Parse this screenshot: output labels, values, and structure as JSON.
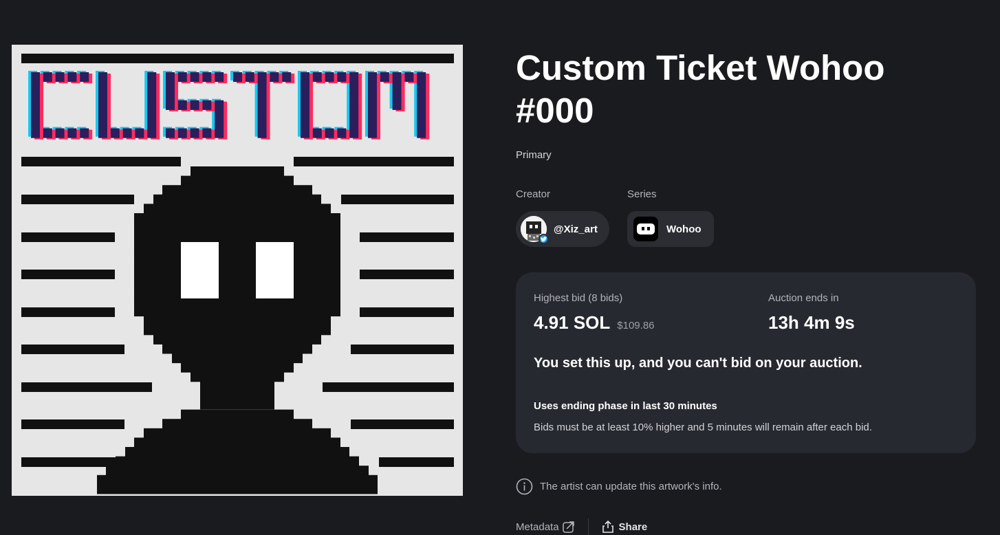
{
  "artwork": {
    "headline_pixels": "CUSTOM",
    "expand_icon": "expand-icon"
  },
  "title": "Custom Ticket Wohoo #000",
  "sale_type": "Primary",
  "creator": {
    "label": "Creator",
    "handle": "@Xiz_art",
    "badge_icon": "twitter-icon"
  },
  "series": {
    "label": "Series",
    "name": "Wohoo"
  },
  "auction": {
    "bid_label": "Highest bid (8 bids)",
    "bid_value": "4.91 SOL",
    "bid_usd": "$109.86",
    "ends_label": "Auction ends in",
    "ends_value": "13h 4m 9s",
    "message": "You set this up, and you can't bid on your auction.",
    "phase_title": "Uses ending phase in last 30 minutes",
    "phase_rules": "Bids must be at least 10% higher and 5 minutes will remain after each bid."
  },
  "info_text": "The artist can update this artwork's info.",
  "links": {
    "metadata": "Metadata",
    "share": "Share"
  },
  "colors": {
    "background": "#1a1b1f",
    "card": "#262930",
    "chip": "#2c2d33",
    "art_bg": "#e6e6e6",
    "pixel_red": "#ff2a5f",
    "pixel_cyan": "#16c8f0",
    "pixel_navy": "#2a1f5c"
  }
}
